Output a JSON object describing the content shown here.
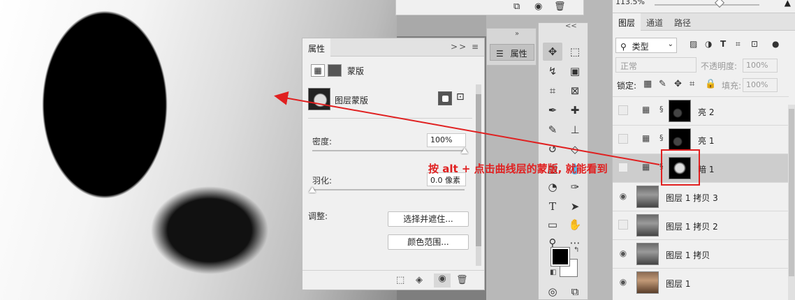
{
  "colors": {
    "accent_red": "#e02020"
  },
  "top_panel": {
    "icons": [
      "new-layer-icon",
      "camera-icon",
      "trash-icon"
    ]
  },
  "collapsed_panel": {
    "label": "属性",
    "icon": "sliders-icon"
  },
  "properties": {
    "tab": "属性",
    "menu": ">>  ≡",
    "mask_title": "蒙版",
    "layer_mask_label": "图层蒙版",
    "density_label": "密度:",
    "density_value": "100%",
    "density_level": 1.0,
    "feather_label": "羽化:",
    "feather_value": "0.0 像素",
    "feather_level": 0.0,
    "adjust_label": "调整:",
    "select_mask_button": "选择并遮住...",
    "color_range_button": "颜色范围..."
  },
  "tools_panel": {
    "chevrons": "<<"
  },
  "layers_panel": {
    "zoom": "113.5%",
    "tabs": [
      "图层",
      "通道",
      "路径"
    ],
    "filter_kind": "类型",
    "blend_mode": "正常",
    "opacity_label": "不透明度:",
    "opacity_value": "100%",
    "lock_label": "锁定:",
    "fill_label": "填充:",
    "fill_value": "100%",
    "layers": [
      {
        "name": "亮 2",
        "visible": false,
        "type": "curves"
      },
      {
        "name": "亮 1",
        "visible": false,
        "type": "curves"
      },
      {
        "name": "暗 1",
        "visible": false,
        "type": "curves",
        "selected": true
      },
      {
        "name": "图层 1 拷贝 3",
        "visible": true,
        "type": "pixel"
      },
      {
        "name": "图层 1 拷贝 2",
        "visible": false,
        "type": "pixel"
      },
      {
        "name": "图层 1 拷贝",
        "visible": true,
        "type": "pixel"
      },
      {
        "name": "图层 1",
        "visible": true,
        "type": "pixel"
      }
    ]
  },
  "annotation": {
    "text": "按 alt + 点击曲线层的蒙版, 就能看到"
  }
}
